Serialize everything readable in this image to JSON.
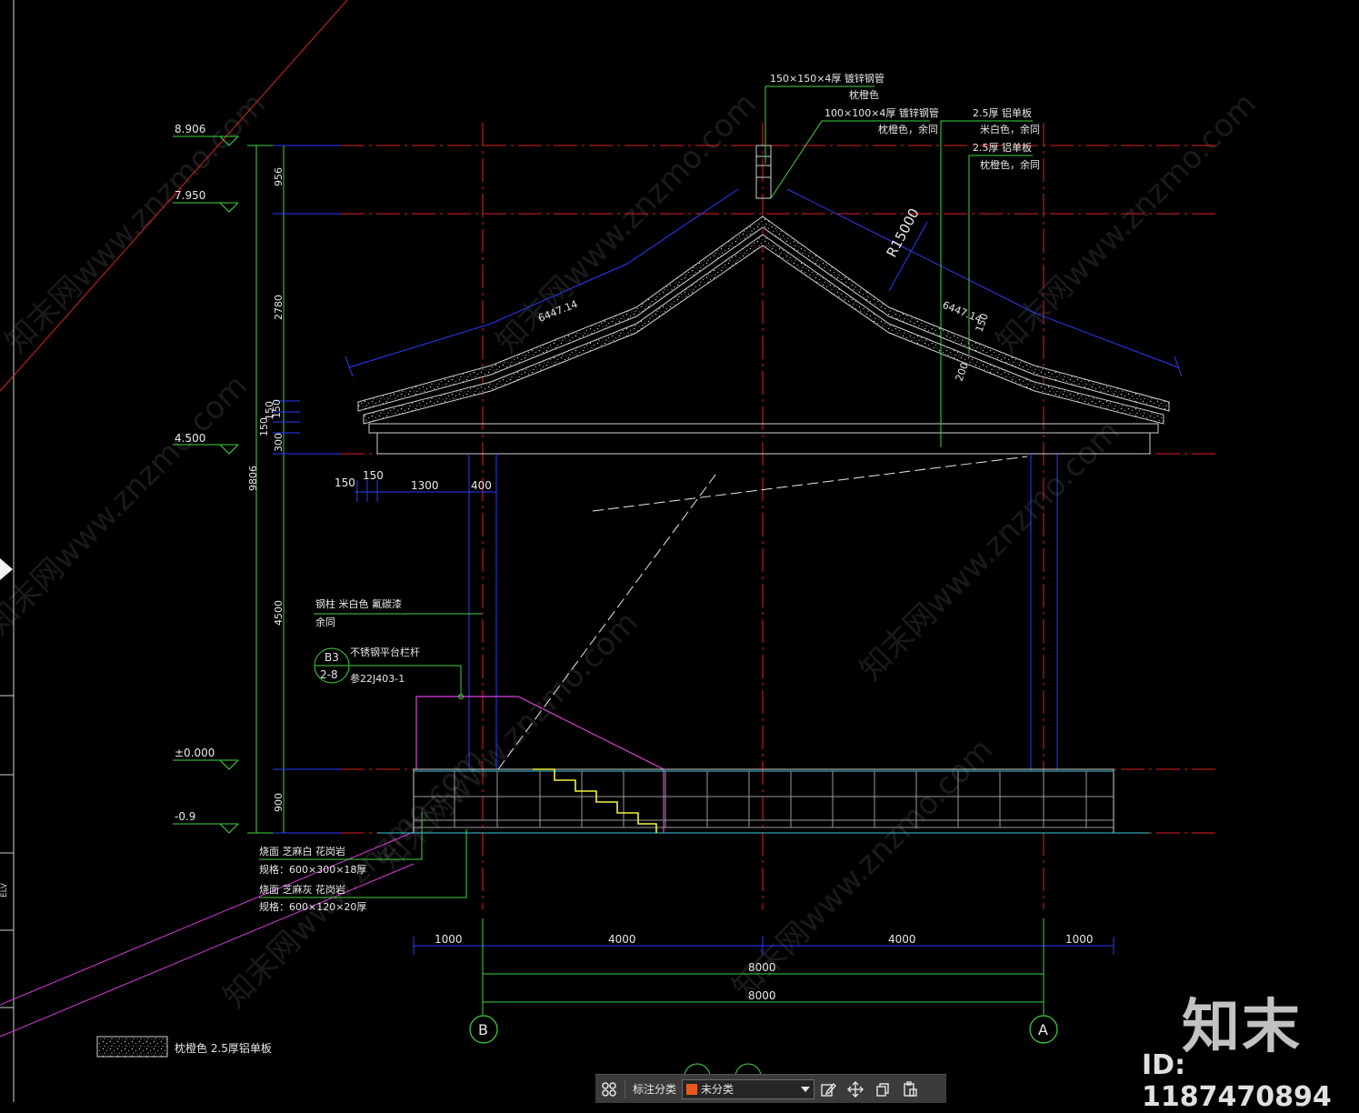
{
  "elevations": [
    "8.906",
    "7.950",
    "4.500",
    "±0.000",
    "-0.9"
  ],
  "vertical_dims": {
    "total": "9806",
    "segments": [
      "956",
      "2780",
      "150",
      "150",
      "300",
      "4500",
      "900"
    ],
    "overlap": "150"
  },
  "horizontal_dims_top": [
    "150",
    "150",
    "1300",
    "400"
  ],
  "horizontal_dims_bottom": [
    "1000",
    "4000",
    "4000",
    "1000"
  ],
  "overall_dims": [
    "8000",
    "8000"
  ],
  "roof": {
    "slope_left": "6447.14",
    "slope_right": "6447.14",
    "radius": "R15000",
    "thk_150": "150",
    "thk_200": "200"
  },
  "annotations": {
    "ridge_tube_1": "150×150×4厚 镀锌钢管",
    "ridge_tube_1_color": "枕橙色",
    "ridge_tube_2": "100×100×4厚 镀锌钢管",
    "ridge_tube_2_color": "枕橙色，余同",
    "al_panel_1": "2.5厚 铝单板",
    "al_panel_1_color": "米白色，余同",
    "al_panel_2": "2.5厚 铝单板",
    "al_panel_2_color": "枕橙色，余同",
    "steel_column": "钢柱 米白色 氟碳漆",
    "steel_column_2": "余同",
    "railing": "不锈钢平台栏杆",
    "railing_ref": "参22J403-1",
    "detail_top": "B3",
    "detail_bottom": "2-8",
    "stone_1": "烧面 芝麻白 花岗岩",
    "stone_1_spec": "规格：600×300×18厚",
    "stone_2": "烧面 芝麻灰 花岗岩",
    "stone_2_spec": "规格：600×120×20厚",
    "legend": "枕橙色 2.5厚铝单板"
  },
  "axes": [
    "B",
    "A"
  ],
  "elv_tab": "ELV",
  "watermark": "知末网www.znzmo.com",
  "brand": "知末",
  "id_text": "ID: 1187470894",
  "toolbar": {
    "label": "标注分类",
    "select_value": "未分类",
    "swatch_color": "#e8581c"
  },
  "colors": {
    "background": "#000000",
    "axis_red": "#e02020",
    "dim_green": "#3ed63e",
    "dim_blue": "#2a3cff",
    "roof_outline": "#d0d0d0",
    "railing_magenta": "#e040e0",
    "stair_yellow": "#f2f23a",
    "cyan_floor": "#38c8d8"
  }
}
